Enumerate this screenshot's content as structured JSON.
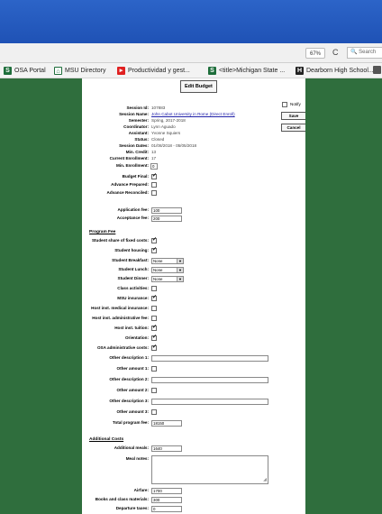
{
  "browser": {
    "zoom": "67%",
    "reload_icon": "reload-icon",
    "search_placeholder": "Search",
    "bookmarks": [
      {
        "label": "OSA Portal",
        "icon": "msu-s-icon"
      },
      {
        "label": "MSU Directory",
        "icon": "spartan-icon"
      },
      {
        "label": "Productividad y gest...",
        "icon": "youtube-icon"
      },
      {
        "label": "<title>Michigan State ...",
        "icon": "msu-s-icon"
      },
      {
        "label": "Dearborn High School...",
        "icon": "school-icon"
      }
    ]
  },
  "page": {
    "edit_button": "Edit Budget",
    "notify_label": "Notify",
    "save_label": "Save",
    "cancel_label": "Cancel",
    "info": {
      "session_id": {
        "label": "Session Id:",
        "value": "107883"
      },
      "session_name": {
        "label": "Session Name:",
        "value": "John Cabot University in Rome (Direct Enroll)"
      },
      "semester": {
        "label": "Semester:",
        "value": "Spring, 2017-2018"
      },
      "coordinator": {
        "label": "Coordinator:",
        "value": "Lynn Aguado"
      },
      "assistant": {
        "label": "Assistant:",
        "value": "Yvonne Squiers"
      },
      "status": {
        "label": "Status:",
        "value": "Closed"
      },
      "session_dates": {
        "label": "Session Dates:",
        "value": "01/08/2018 - 05/05/2018"
      },
      "min_credit": {
        "label": "Min. Credit:",
        "value": "13"
      },
      "current_enrollment": {
        "label": "Current Enrollment:",
        "value": "17"
      }
    },
    "min_enrollment": {
      "label": "Min. Enrollment:",
      "value": "0"
    },
    "budget_final": {
      "label": "Budget Final:",
      "checked": true
    },
    "advance_prepared": {
      "label": "Advance Prepared:",
      "checked": false
    },
    "advance_reconciled": {
      "label": "Advance Reconciled:",
      "checked": false
    },
    "application_fee": {
      "label": "Application fee:",
      "value": "100"
    },
    "acceptance_fee": {
      "label": "Acceptance fee:",
      "value": "200"
    },
    "program_fee": {
      "title": "Program Fee",
      "fixed_costs": {
        "label": "Student share of fixed costs:",
        "checked": true
      },
      "housing": {
        "label": "Student housing:",
        "checked": true
      },
      "breakfast": {
        "label": "Student Breakfast:",
        "value": "None"
      },
      "lunch": {
        "label": "Student Lunch:",
        "value": "None"
      },
      "dinner": {
        "label": "Student Dinner:",
        "value": "None"
      },
      "class_activities": {
        "label": "Class activities:",
        "checked": false
      },
      "msu_insurance": {
        "label": "MSU insurance:",
        "checked": true
      },
      "host_medical": {
        "label": "Host inst. medical insurance:",
        "checked": false
      },
      "host_admin": {
        "label": "Host inst. administrative fee:",
        "checked": false
      },
      "host_tuition": {
        "label": "Host inst. tuition:",
        "checked": true
      },
      "orientation": {
        "label": "Orientation:",
        "checked": true
      },
      "osa_admin": {
        "label": "OSA administrative costs:",
        "checked": true
      },
      "other_desc_1": {
        "label": "Other description 1:",
        "value": ""
      },
      "other_amount_1": {
        "label": "Other amount 1:",
        "checked": false
      },
      "other_desc_2": {
        "label": "Other description 2:",
        "value": ""
      },
      "other_amount_2": {
        "label": "Other amount 2:",
        "checked": false
      },
      "other_desc_3": {
        "label": "Other description 3:",
        "value": ""
      },
      "other_amount_3": {
        "label": "Other amount 3:",
        "checked": false
      },
      "total": {
        "label": "Total program fee:",
        "value": "18150"
      }
    },
    "additional_costs": {
      "title": "Additional Costs",
      "meals": {
        "label": "Additional meals:",
        "value": "1640"
      },
      "meal_notes": {
        "label": "Meal notes:",
        "value": ""
      },
      "airfare": {
        "label": "Airfare:",
        "value": "1700"
      },
      "books": {
        "label": "Books and class materials:",
        "value": "300"
      },
      "departure_taxes": {
        "label": "Departure taxes:",
        "value": "0"
      }
    }
  },
  "colors": {
    "page_bg": "#2f6e3d",
    "title_bar": "#2c64c8",
    "link": "#2222aa"
  }
}
